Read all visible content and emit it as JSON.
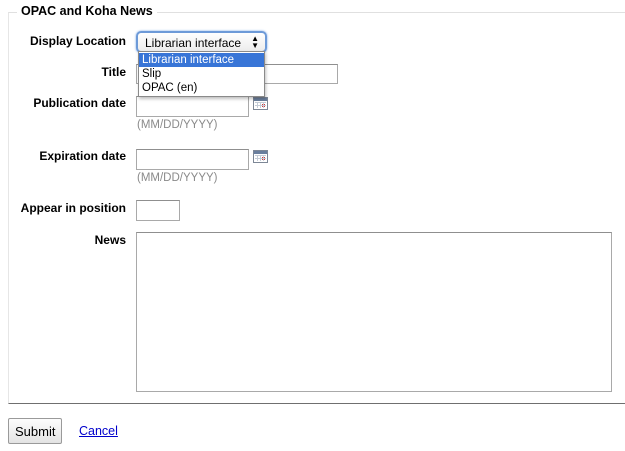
{
  "form": {
    "legend": "OPAC and Koha News",
    "display_location": {
      "label": "Display Location",
      "selected": "Librarian interface",
      "options": [
        "Librarian interface",
        "Slip",
        "OPAC (en)"
      ]
    },
    "title": {
      "label": "Title",
      "value": ""
    },
    "publication_date": {
      "label": "Publication date",
      "value": "",
      "hint": "(MM/DD/YYYY)"
    },
    "expiration_date": {
      "label": "Expiration date",
      "value": "",
      "hint": "(MM/DD/YYYY)"
    },
    "appear_in_position": {
      "label": "Appear in position",
      "value": ""
    },
    "news": {
      "label": "News",
      "value": ""
    }
  },
  "actions": {
    "submit_label": "Submit",
    "cancel_label": "Cancel"
  },
  "colors": {
    "selected_option_bg": "#3875d7",
    "link": "#0000cc",
    "hint_text": "#8a8a8a",
    "focus_ring": "#6d9ad8"
  },
  "icons": {
    "calendar": "calendar-icon",
    "select_arrows": "updown-arrows-icon"
  }
}
